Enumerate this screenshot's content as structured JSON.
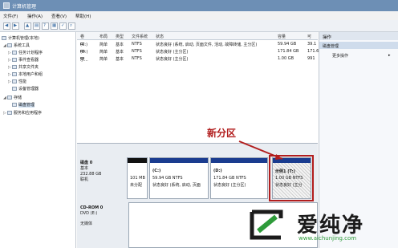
{
  "window": {
    "title": "计算机管理"
  },
  "menu": [
    "文件(F)",
    "操作(A)",
    "查看(V)",
    "帮助(H)"
  ],
  "toolbar": {
    "buttons": [
      "back-icon",
      "forward-icon",
      "up-icon",
      "properties-icon",
      "help-icon",
      "disk-icon",
      "check-icon",
      "search-icon"
    ]
  },
  "tree": {
    "items": [
      {
        "label": "计算机管理(本地)",
        "level": 0,
        "toggle": ""
      },
      {
        "label": "系统工具",
        "level": 1,
        "toggle": "◢"
      },
      {
        "label": "任务计划程序",
        "level": 2,
        "toggle": "▷"
      },
      {
        "label": "事件查看器",
        "level": 2,
        "toggle": "▷"
      },
      {
        "label": "共享文件夹",
        "level": 2,
        "toggle": "▷"
      },
      {
        "label": "本地用户和组",
        "level": 2,
        "toggle": "▷"
      },
      {
        "label": "性能",
        "level": 2,
        "toggle": "▷"
      },
      {
        "label": "设备管理器",
        "level": 2,
        "toggle": ""
      },
      {
        "label": "存储",
        "level": 1,
        "toggle": "◢"
      },
      {
        "label": "磁盘管理",
        "level": 2,
        "toggle": ""
      },
      {
        "label": "服务和应用程序",
        "level": 1,
        "toggle": "▷"
      }
    ]
  },
  "volume_list": {
    "columns": [
      "卷",
      "布局",
      "类型",
      "文件系统",
      "状态",
      "容量",
      "可"
    ],
    "rows": [
      {
        "vol": "(C:)",
        "layout": "简单",
        "type": "基本",
        "fs": "NTFS",
        "status": "状态良好 (系统, 启动, 页面文件, 活动, 故障转储, 主分区)",
        "cap": "59.94 GB",
        "free": "39.1"
      },
      {
        "vol": "(D:)",
        "layout": "简单",
        "type": "基本",
        "fs": "NTFS",
        "status": "状态良好 (主分区)",
        "cap": "171.84 GB",
        "free": "171.6"
      },
      {
        "vol": "示...",
        "layout": "简单",
        "type": "基本",
        "fs": "NTFS",
        "status": "状态良好 (主分区)",
        "cap": "1.00 GB",
        "free": "991"
      }
    ]
  },
  "actions": {
    "header": "操作",
    "section": "磁盘管理",
    "more": "更多操作",
    "arrow": "▸"
  },
  "disk0": {
    "name": "磁盘 0",
    "type": "基本",
    "size": "232.88 GB",
    "state": "联机",
    "partitions": [
      {
        "title": "",
        "size": "101 MB",
        "status": "未分配"
      },
      {
        "title": "(C:)",
        "size": "59.94 GB NTFS",
        "status": "状态良好 (系统, 启动, 页面"
      },
      {
        "title": "(D:)",
        "size": "171.84 GB NTFS",
        "status": "状态良好 (主分区)"
      },
      {
        "title": "示例1 (T:)",
        "size": "1.00 GB NTFS",
        "status": "状态良好 (主分"
      }
    ]
  },
  "cdrom": {
    "name": "CD-ROM 0",
    "type": "DVD (E:)",
    "state": "无媒体"
  },
  "callout": {
    "text": "新分区",
    "color": "#b21e1e"
  },
  "watermark": {
    "name": "爱纯净",
    "url": "www.aichunjing.com"
  }
}
